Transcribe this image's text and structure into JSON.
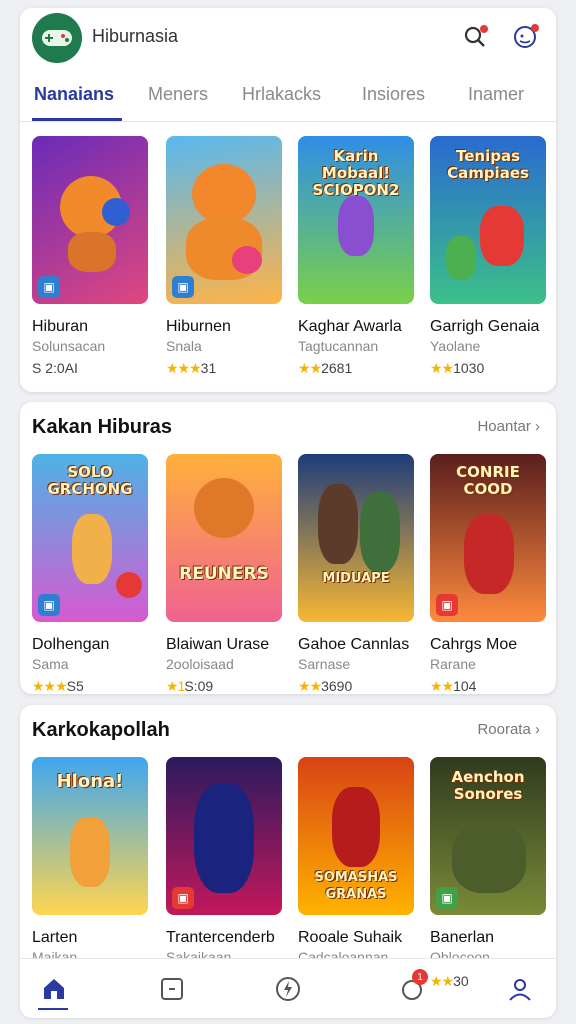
{
  "app": {
    "title": "Hiburnasia"
  },
  "tabs": [
    "Nanaians",
    "Meners",
    "Hrlakacks",
    "Insiores",
    "Inamer"
  ],
  "top_section": {
    "items": [
      {
        "title": "Hiburan",
        "subtitle": "Solunsacan",
        "rating_text": "S 2:0AI",
        "stars": "",
        "color1": "#6a2bb8",
        "color2": "#e0477f",
        "caption": ""
      },
      {
        "title": "Hiburnen",
        "subtitle": "Snala",
        "rating_text": "31",
        "stars": "★★★",
        "color1": "#58b8f0",
        "color2": "#ffb347",
        "caption": ""
      },
      {
        "title": "Kaghar Awarla",
        "subtitle": "Tagtucannan",
        "rating_text": "2681",
        "stars": "★★",
        "color1": "#2f8ee6",
        "color2": "#7ad04a",
        "caption": "Karin Mobaal! SCIOPON2"
      },
      {
        "title": "Garrigh Genaia",
        "subtitle": "Yaolane",
        "rating_text": "1030",
        "stars": "★★",
        "color1": "#2a6ad0",
        "color2": "#3cc089",
        "caption": "Tenipas Campiaes"
      }
    ]
  },
  "section2": {
    "heading": "Kakan Hiburas",
    "more": "Hoantar",
    "items": [
      {
        "title": "Dolhengan",
        "subtitle": "Sama",
        "rating_text": "S5",
        "stars": "★★★",
        "color1": "#4db3e6",
        "color2": "#d65ad0",
        "caption": "SOLO GRCHONG"
      },
      {
        "title": "Blaiwan Urase",
        "subtitle": "2ooloisaad",
        "rating_text": "S:09",
        "stars": "★1",
        "color1": "#ffb13b",
        "color2": "#f06292",
        "caption": "REUNERS"
      },
      {
        "title": "Gahoe Cannlas",
        "subtitle": "Sarnase",
        "rating_text": "3690",
        "stars": "★★",
        "color1": "#1e3c7a",
        "color2": "#f7b733",
        "caption": "MIDUAPE"
      },
      {
        "title": "Cahrgs Moe",
        "subtitle": "Rarane",
        "rating_text": "104",
        "stars": "★★",
        "color1": "#5a1e1e",
        "color2": "#ff8a3d",
        "caption": "CONRIE COOD"
      }
    ]
  },
  "section3": {
    "heading": "Karkokapollah",
    "more": "Roorata",
    "items": [
      {
        "title": "Larten",
        "subtitle": "Maikan",
        "color1": "#3fa6ef",
        "color2": "#ffd54f",
        "caption": "Hlona!"
      },
      {
        "title": "Trantercenderb",
        "subtitle": "Sakaikaan",
        "color1": "#2a1a5e",
        "color2": "#c2185b",
        "caption": ""
      },
      {
        "title": "Rooale Suhaik",
        "subtitle": "Cadcaloannan",
        "color1": "#d84315",
        "color2": "#ffb300",
        "caption": "SOMASHAS GRANAS"
      },
      {
        "title": "Banerlan",
        "subtitle": "Oblocoon",
        "color1": "#2e3b1f",
        "color2": "#7a8a38",
        "caption": "Aenchon Sonores"
      }
    ]
  },
  "bottom_nav": {
    "rating_text": "30",
    "stars": "★★",
    "notif_count": "1"
  }
}
